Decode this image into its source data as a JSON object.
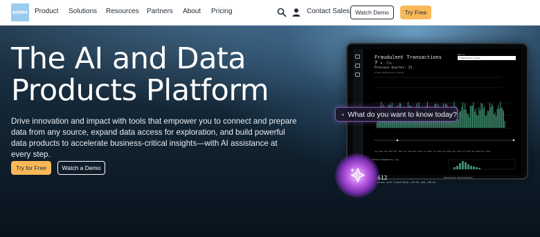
{
  "nav": {
    "logo": "DOMO",
    "items": [
      "Product",
      "Solutions",
      "Resources",
      "Partners",
      "About",
      "Pricing"
    ],
    "contact_sales": "Contact Sales",
    "watch_demo": "Watch Demo",
    "try_free": "Try Free",
    "icons": [
      "search-icon",
      "user-icon"
    ]
  },
  "hero": {
    "headline": "The AI and Data Products Platform",
    "subtext": "Drive innovation and impact with tools that empower you to connect and prepare data from any source, expand data access for exploration, and build powerful data products to accelerate business-critical insights—with AI assistance at every step.",
    "cta_primary": "Try for Free",
    "cta_secondary": "Watch a Demo"
  },
  "device": {
    "card_title": "Fraudulent Transactions",
    "kpi_value": "7",
    "kpi_change": "▼ -72%",
    "prev_quarter": "Previous Quarter: 25",
    "small_line1": "Fraud Prediction Trends",
    "metric_label": "Metric",
    "metric_value": "Transaction Count",
    "fraud_probability_label": "Fraud Probability (%)",
    "kpi2_value": "612",
    "kpi2_sub": "cords with Fraud Risk +10.0% and +90.0%",
    "prediction_label": "Prediction Distribution",
    "x_axis_labels": "Jan 2024  Feb 2024  Mar 2024  Apr 2024  May 2024  Jun 2024  Jul 2024  Aug 2024  Sep 2024  Oct 2024  Nov 2024  Dec 2024"
  },
  "assistant": {
    "prompt": "What do you want to know today?",
    "icon": "sparkle-icon"
  },
  "colors": {
    "accent_orange": "#f8b858",
    "chart_green": "#3e8e6e",
    "assistant_purple": "#7b5aa8"
  }
}
